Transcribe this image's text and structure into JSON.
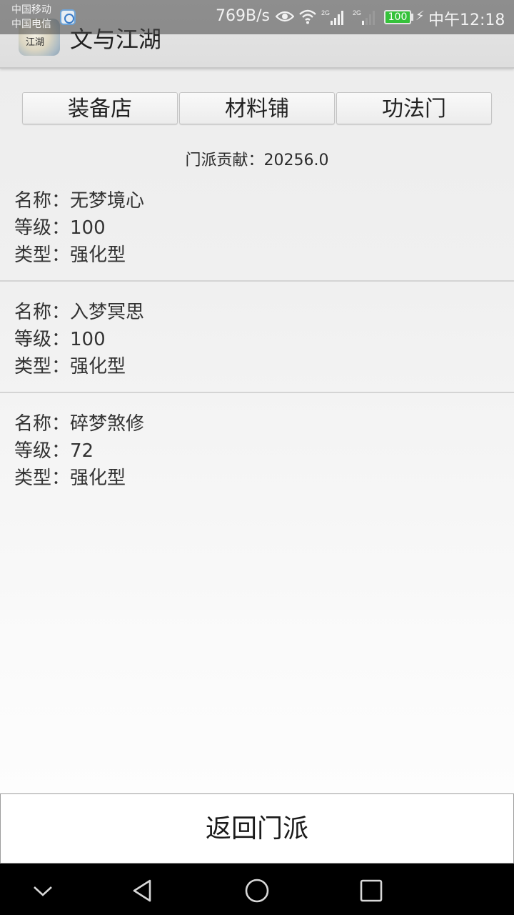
{
  "status_bar": {
    "carrier_1": "中国移动",
    "carrier_2": "中国电信",
    "net_speed": "769B/s",
    "signal_1_label": "2G",
    "signal_2_label": "2G",
    "battery": "100",
    "time": "中午12:18",
    "icons": [
      "eye-icon",
      "wifi-icon",
      "signal-icon",
      "signal-icon",
      "battery-icon",
      "charging-icon"
    ]
  },
  "app_bar": {
    "title": "文与江湖",
    "icon_text": "江湖"
  },
  "tabs": [
    {
      "label": "装备店"
    },
    {
      "label": "材料铺"
    },
    {
      "label": "功法门"
    }
  ],
  "contribution": "门派贡献：20256.0",
  "items": [
    {
      "name": "名称：无梦境心",
      "level": "等级：100",
      "type": "类型：强化型"
    },
    {
      "name": "名称：入梦冥思",
      "level": "等级：100",
      "type": "类型：强化型"
    },
    {
      "name": "名称：碎梦煞修",
      "level": "等级：72",
      "type": "类型：强化型"
    }
  ],
  "return_button": "返回门派",
  "nav_bar": {
    "icons": [
      "chevron-down-icon",
      "back-icon",
      "home-icon",
      "recents-icon"
    ]
  },
  "colors": {
    "battery": "#35c23a",
    "status_overlay": "#464646",
    "nav_bg": "#000000"
  }
}
